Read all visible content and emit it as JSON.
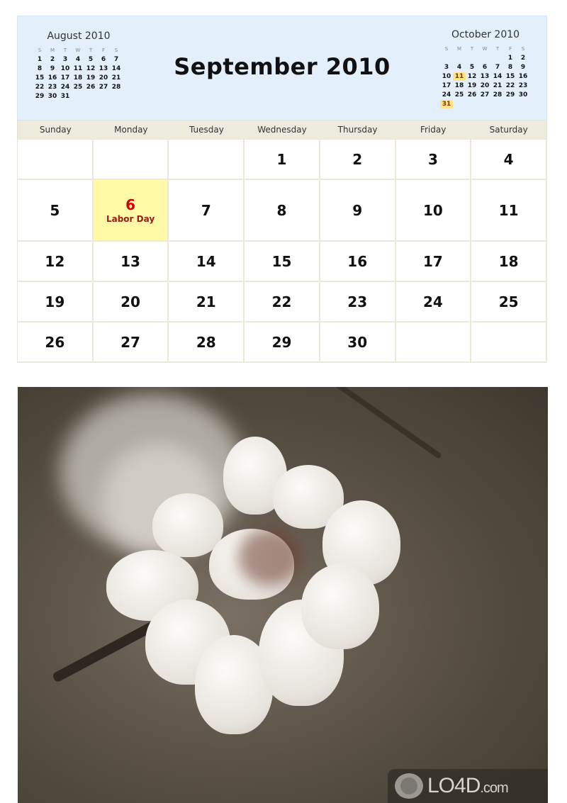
{
  "calendar": {
    "title": "September 2010",
    "prev_month": {
      "title": "August 2010",
      "dow": [
        "S",
        "M",
        "T",
        "W",
        "T",
        "F",
        "S"
      ],
      "lead_blanks": 0,
      "days": [
        "1",
        "2",
        "3",
        "4",
        "5",
        "6",
        "7",
        "8",
        "9",
        "10",
        "11",
        "12",
        "13",
        "14",
        "15",
        "16",
        "17",
        "18",
        "19",
        "20",
        "21",
        "22",
        "23",
        "24",
        "25",
        "26",
        "27",
        "28",
        "29",
        "30",
        "31"
      ],
      "highlighted": []
    },
    "next_month": {
      "title": "October 2010",
      "dow": [
        "S",
        "M",
        "T",
        "W",
        "T",
        "F",
        "S"
      ],
      "lead_blanks": 5,
      "days": [
        "1",
        "2",
        "3",
        "4",
        "5",
        "6",
        "7",
        "8",
        "9",
        "10",
        "11",
        "12",
        "13",
        "14",
        "15",
        "16",
        "17",
        "18",
        "19",
        "20",
        "21",
        "22",
        "23",
        "24",
        "25",
        "26",
        "27",
        "28",
        "29",
        "30",
        "31"
      ],
      "highlighted": [
        "11",
        "31"
      ]
    },
    "weekdays": [
      "Sunday",
      "Monday",
      "Tuesday",
      "Wednesday",
      "Thursday",
      "Friday",
      "Saturday"
    ],
    "weeks": [
      [
        "",
        "",
        "",
        "1",
        "2",
        "3",
        "4"
      ],
      [
        "5",
        "6",
        "7",
        "8",
        "9",
        "10",
        "11"
      ],
      [
        "12",
        "13",
        "14",
        "15",
        "16",
        "17",
        "18"
      ],
      [
        "19",
        "20",
        "21",
        "22",
        "23",
        "24",
        "25"
      ],
      [
        "26",
        "27",
        "28",
        "29",
        "30",
        "",
        ""
      ]
    ],
    "holidays": {
      "6": "Labor Day"
    }
  },
  "photo": {
    "subject": "white almond blossom on branch"
  },
  "watermark": {
    "brand": "LO4D",
    "suffix": ".com"
  }
}
